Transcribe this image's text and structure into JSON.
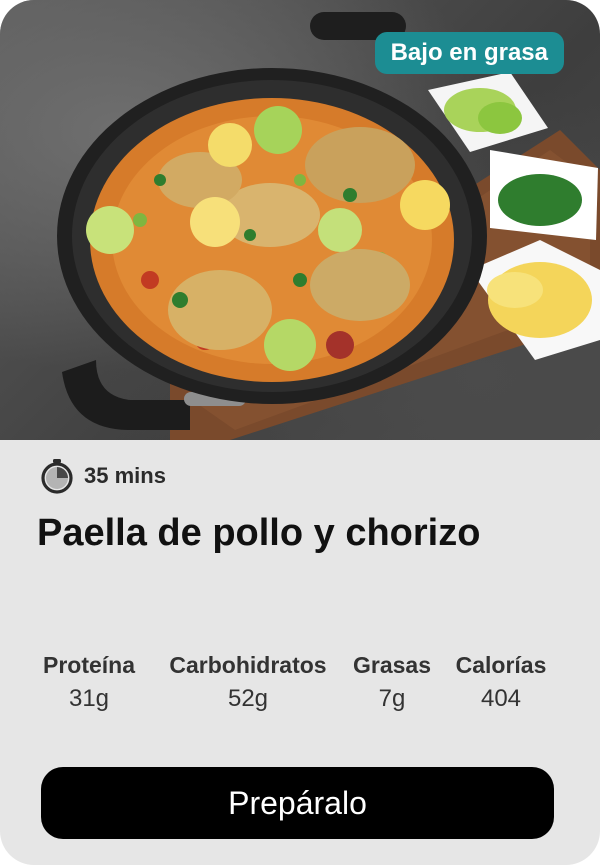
{
  "card": {
    "badge": "Bajo en grasa",
    "time": "35 mins",
    "title": "Paella de pollo y chorizo",
    "macros": [
      {
        "label": "Proteína",
        "value": "31g"
      },
      {
        "label": "Carbohidratos",
        "value": "52g"
      },
      {
        "label": "Grasas",
        "value": "7g"
      },
      {
        "label": "Calorías",
        "value": "404"
      }
    ],
    "cta": "Prepáralo"
  },
  "colors": {
    "badge_bg": "#1c8d93",
    "card_bg": "#e6e6e6",
    "button_bg": "#000000"
  },
  "icons": {
    "time": "stopwatch-icon"
  }
}
